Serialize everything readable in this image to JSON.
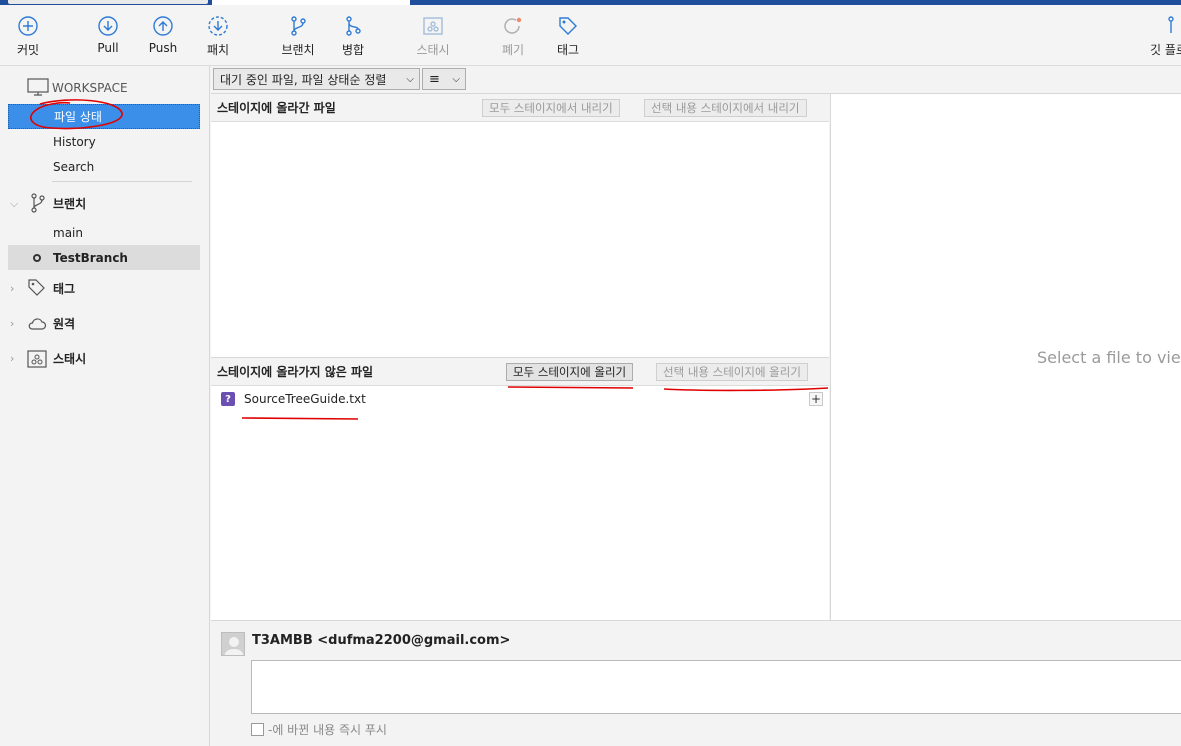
{
  "toolbar": {
    "commit": "커밋",
    "pull": "Pull",
    "push": "Push",
    "fetch": "패치",
    "branch": "브랜치",
    "merge": "병합",
    "stash": "스태시",
    "discard": "폐기",
    "tag": "태그",
    "git_flow": "깃 플로"
  },
  "sidebar": {
    "workspace": "WORKSPACE",
    "file_status": "파일 상태",
    "history": "History",
    "search": "Search",
    "branches_label": "브랜치",
    "branches": [
      "main",
      "TestBranch"
    ],
    "tags_label": "태그",
    "remotes_label": "원격",
    "stashes_label": "스태시"
  },
  "filter": {
    "sort_label": "대기 중인 파일, 파일 상태순 정렬",
    "view_icon": "≡"
  },
  "staged": {
    "title": "스테이지에 올라간 파일",
    "unstage_all": "모두 스테이지에서 내리기",
    "unstage_selected": "선택 내용 스테이지에서 내리기"
  },
  "unstaged": {
    "title": "스테이지에 올라가지 않은 파일",
    "stage_all": "모두 스테이지에 올리기",
    "stage_selected": "선택 내용 스테이지에 올리기",
    "files": [
      {
        "name": "SourceTreeGuide.txt",
        "status_icon": "?"
      }
    ]
  },
  "diff": {
    "placeholder": "Select a file to view"
  },
  "commit": {
    "author": "T3AMBB <dufma2200@gmail.com>",
    "push_immediately": "-에 바뀐 내용 즉시 푸시"
  },
  "colors": {
    "selection": "#3b8fe8",
    "accent": "#1f4e9c",
    "annotation": "#e00000",
    "untracked_icon": "#6b4fb3"
  }
}
